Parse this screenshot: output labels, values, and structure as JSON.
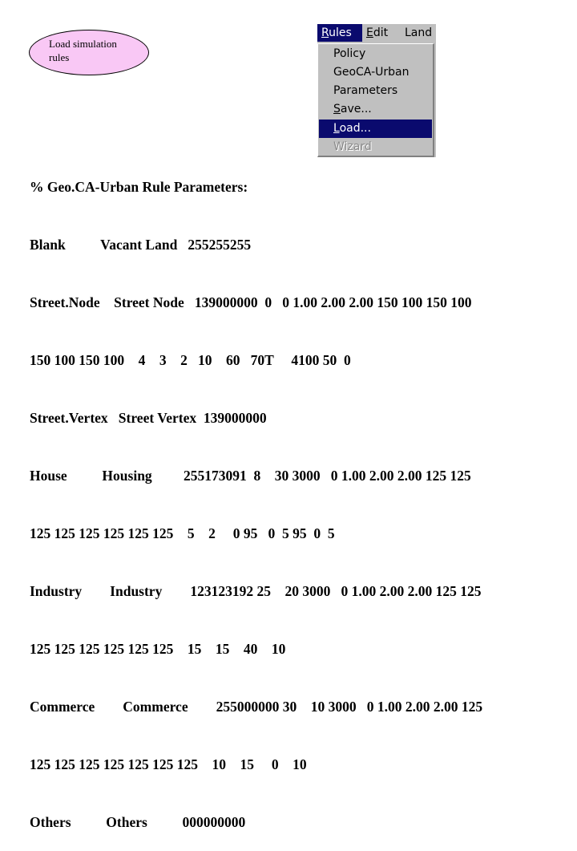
{
  "callout": {
    "line1": "Load simulation",
    "line2": "rules",
    "fill_color": "#f9c8f5"
  },
  "menu": {
    "menubar": [
      {
        "label_prefix": "",
        "mnemonic": "R",
        "label_suffix": "ules",
        "active": true
      },
      {
        "label_prefix": "",
        "mnemonic": "E",
        "label_suffix": "dit",
        "active": false
      },
      {
        "label_prefix": "Land",
        "mnemonic": "",
        "label_suffix": "",
        "active": false
      }
    ],
    "items": [
      {
        "label": "Policy",
        "state": "normal"
      },
      {
        "label": "GeoCA-Urban",
        "state": "normal"
      },
      {
        "label": "Parameters",
        "state": "normal"
      },
      {
        "mnemonic": "S",
        "label_suffix": "ave...",
        "state": "normal"
      },
      {
        "mnemonic": "L",
        "label_suffix": "oad...",
        "state": "highlighted"
      },
      {
        "label": "Wizard",
        "state": "disabled"
      }
    ],
    "highlight_color": "#0a0a6e",
    "menu_bg_color": "#c0c0c0"
  },
  "parameters": {
    "title": "% Geo.CA-Urban Rule Parameters:",
    "lines": [
      "Blank          Vacant Land   255255255",
      "Street.Node    Street Node   139000000  0   0 1.00 2.00 2.00 150 100 150 100",
      "150 100 150 100    4    3    2   10    60   70T     4100 50  0",
      "Street.Vertex   Street Vertex  139000000",
      "House          Housing         255173091  8    30 3000   0 1.00 2.00 2.00 125 125",
      "125 125 125 125 125 125    5    2     0 95   0  5 95  0  5",
      "Industry        Industry        123123192 25    20 3000   0 1.00 2.00 2.00 125 125",
      "125 125 125 125 125 125    15    15    40    10",
      "Commerce        Commerce        255000000 30    10 3000   0 1.00 2.00 2.00 125",
      "125 125 125 125 125 125 125    10    15     0    10",
      "Others          Others          000000000"
    ]
  }
}
